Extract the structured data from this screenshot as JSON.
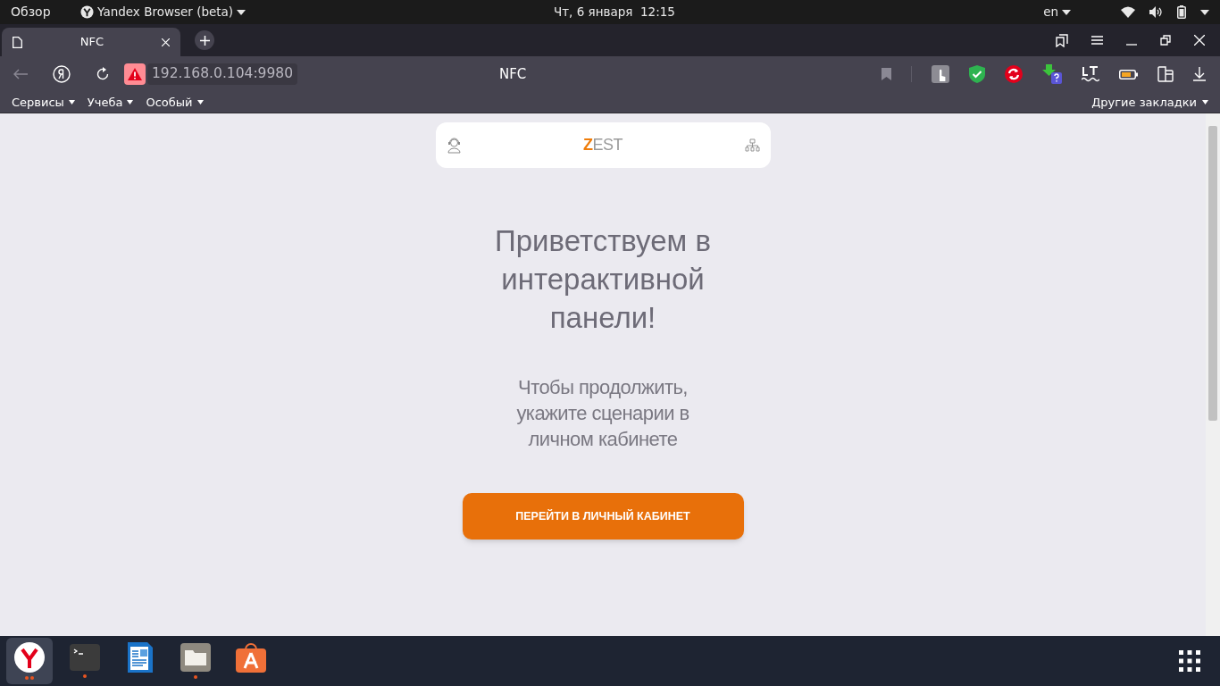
{
  "top_bar": {
    "activities": "Обзор",
    "app_menu": "Yandex Browser (beta)",
    "clock": "Чт, 6 января  12:15",
    "language": "en"
  },
  "tabs": [
    {
      "title": "NFC",
      "selected": true
    }
  ],
  "address_bar": {
    "url": "192.168.0.104:9980",
    "page_title": "NFC"
  },
  "bookmarks": [
    {
      "label": "Сервисы"
    },
    {
      "label": "Учеба"
    },
    {
      "label": "Особый"
    }
  ],
  "other_bookmarks": "Другие закладки",
  "page": {
    "logo": {
      "accent": "Z",
      "rest": "EST"
    },
    "heading": "Приветствуем в интерактивной панели!",
    "subtitle": "Чтобы продолжить, укажите сценарии в личном кабинете",
    "button": "ПЕРЕЙТИ В ЛИЧНЫЙ КАБИНЕТ"
  },
  "dock": [
    {
      "kind": "yandex",
      "selected": true,
      "running": true,
      "multiple_windows": true
    },
    {
      "kind": "terminal",
      "selected": false,
      "running": true,
      "multiple_windows": false
    },
    {
      "kind": "writer",
      "selected": false,
      "running": false,
      "multiple_windows": false
    },
    {
      "kind": "files",
      "selected": false,
      "running": true,
      "multiple_windows": false
    },
    {
      "kind": "store",
      "selected": false,
      "running": false,
      "multiple_windows": false
    }
  ]
}
